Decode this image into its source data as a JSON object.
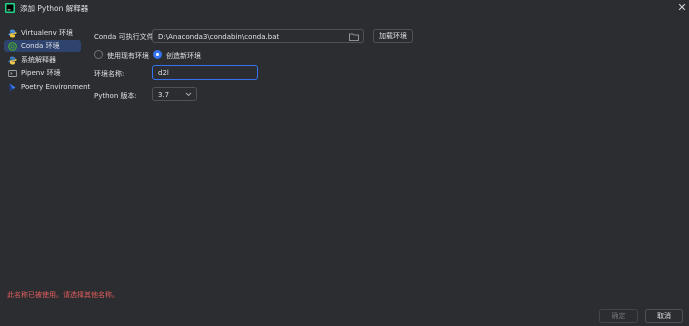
{
  "window": {
    "title": "添加 Python 解释器",
    "icons": {
      "app": "pycharm-app-icon",
      "close": "close-icon"
    }
  },
  "sidebar": {
    "items": [
      {
        "label": "Virtualenv 环境",
        "icon": "virtualenv-icon",
        "selected": false
      },
      {
        "label": "Conda 环境",
        "icon": "conda-icon",
        "selected": true
      },
      {
        "label": "系统解释器",
        "icon": "python-icon",
        "selected": false
      },
      {
        "label": "Pipenv 环境",
        "icon": "pipenv-icon",
        "selected": false
      },
      {
        "label": "Poetry Environment",
        "icon": "poetry-icon",
        "selected": false
      }
    ]
  },
  "form": {
    "conda_exec_label": "Conda 可执行文件:",
    "conda_exec_value": "D:\\Anaconda3\\condabin\\conda.bat",
    "load_env_button": "加载环境",
    "radio_existing_label": "使用现有环境",
    "radio_new_label": "创造新环境",
    "radio_selected": "new",
    "env_name_label": "环境名称:",
    "env_name_value": "d2l",
    "python_version_label": "Python 版本:",
    "python_version_value": "3.7"
  },
  "error_message": "此名称已被使用。请选择其他名称。",
  "footer": {
    "ok_button": "确定",
    "ok_enabled": false,
    "cancel_button": "取消"
  },
  "colors": {
    "background": "#2b2d30",
    "selection": "#2e436e",
    "accent": "#3574f0",
    "error": "#e55e5e",
    "text": "#dfe1e5"
  }
}
